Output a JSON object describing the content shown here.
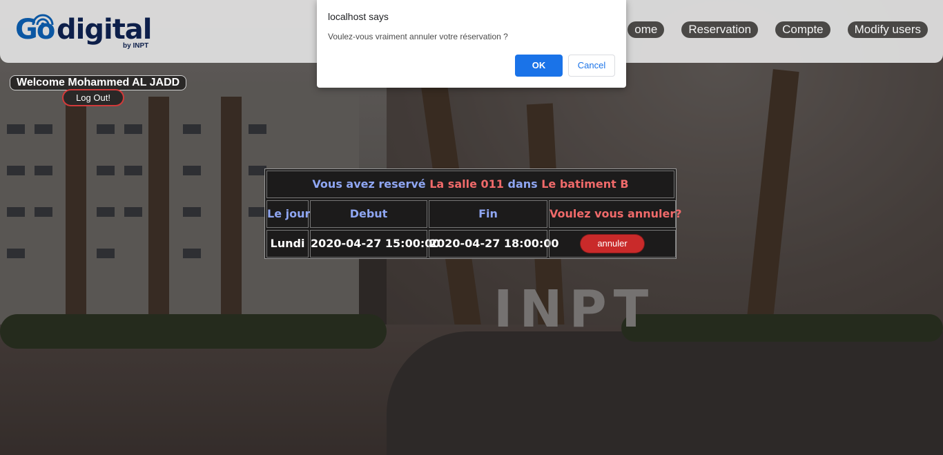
{
  "header": {
    "logo_go": "Go",
    "logo_digital": "digital",
    "logo_by": "by INPT",
    "nav": [
      "ome",
      "Reservation",
      "Compte",
      "Modify users"
    ]
  },
  "user": {
    "welcome": "Welcome Mohammed AL JADD",
    "logout_label": "Log Out!"
  },
  "reservation": {
    "title_prefix": "Vous avez reservé",
    "room": "La salle 011",
    "title_mid": "dans",
    "building": "Le batiment B",
    "columns": [
      "Le jour",
      "Debut",
      "Fin",
      "Voulez vous annuler?"
    ],
    "row": {
      "day": "Lundi",
      "start": "2020-04-27 15:00:00",
      "end": "2020-04-27 18:00:00",
      "action_label": "annuler"
    }
  },
  "background": {
    "sign_text": "INPT"
  },
  "dialog": {
    "title": "localhost says",
    "message": "Voulez-vous vraiment annuler votre réservation ?",
    "ok_label": "OK",
    "cancel_label": "Cancel"
  },
  "colors": {
    "accent_blue": "#1a73e8",
    "title_blue": "#8fa6f2",
    "title_red": "#f06a6a",
    "button_red": "#c92a2a"
  }
}
